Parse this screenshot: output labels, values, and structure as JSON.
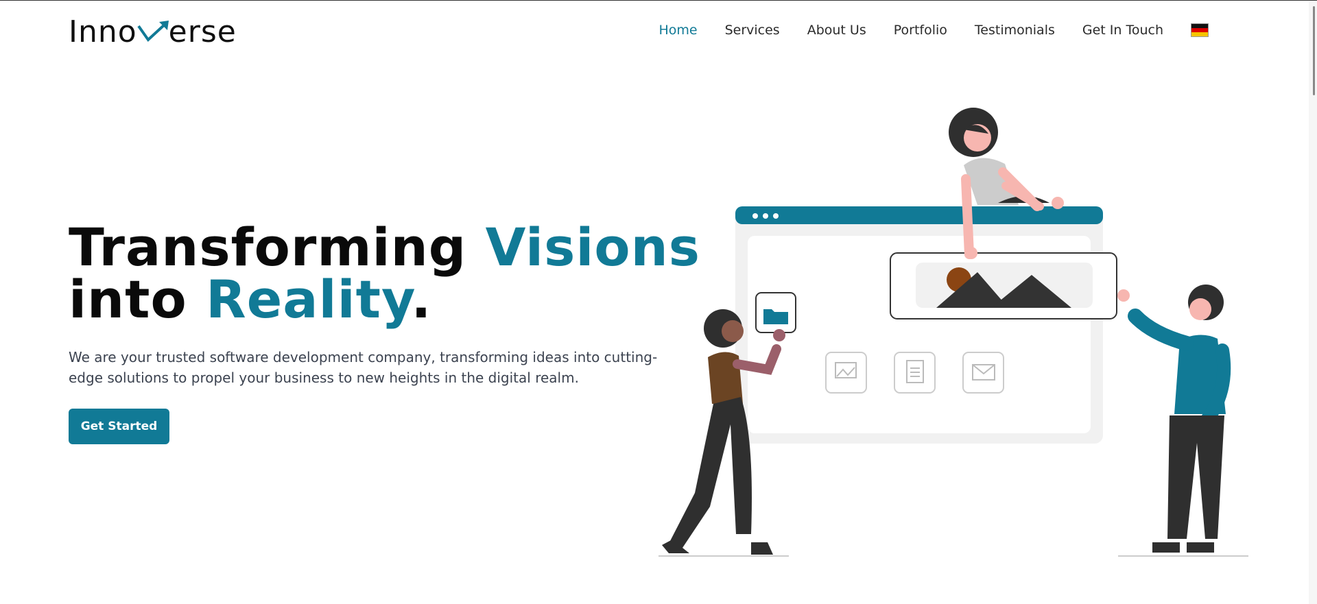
{
  "header": {
    "logo_text_start": "Inno",
    "logo_text_end": "erse",
    "nav": [
      {
        "label": "Home",
        "active": true
      },
      {
        "label": "Services",
        "active": false
      },
      {
        "label": "About Us",
        "active": false
      },
      {
        "label": "Portfolio",
        "active": false
      },
      {
        "label": "Testimonials",
        "active": false
      },
      {
        "label": "Get In Touch",
        "active": false
      }
    ],
    "language_flag": "germany-flag-icon"
  },
  "hero": {
    "title_part1": "Transforming",
    "title_part2": "Visions",
    "title_part3": "into",
    "title_part4": "Reality",
    "title_part5": ".",
    "description": "We are your trusted software development company, transforming ideas into cutting-edge solutions to propel your business to new heights in the digital realm.",
    "cta_label": "Get Started"
  },
  "colors": {
    "accent": "#117a96",
    "text_dark": "#0a0a0a",
    "nav_text": "#2b2b2b"
  }
}
